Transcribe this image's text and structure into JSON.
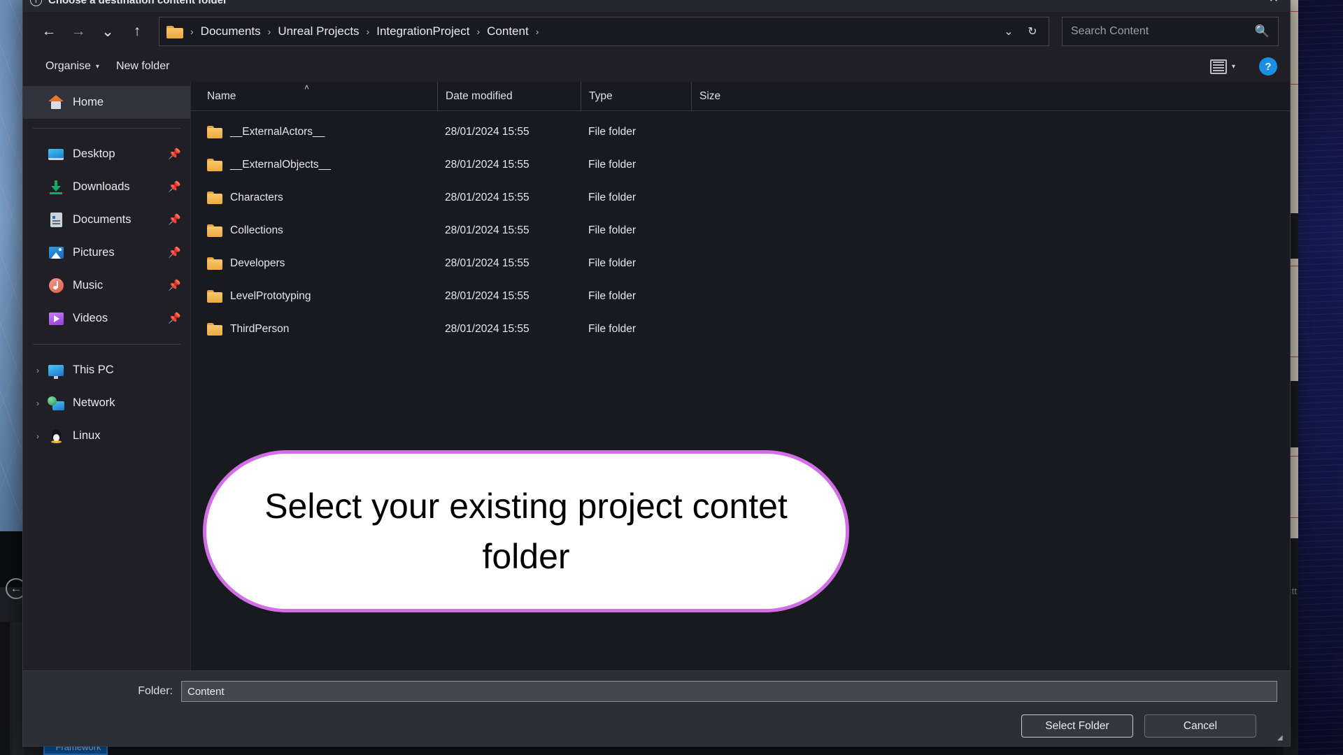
{
  "window": {
    "title": "Choose a destination content folder",
    "title_icon": "info-icon",
    "close_label": "✕"
  },
  "navbar": {
    "back_label": "←",
    "forward_label": "→",
    "recent_label": "⌄",
    "up_label": "↑",
    "breadcrumb": [
      "Documents",
      "Unreal Projects",
      "IntegrationProject",
      "Content"
    ],
    "breadcrumb_separator": "›",
    "dropdown_label": "⌄",
    "refresh_label": "↻",
    "search_placeholder": "Search Content",
    "search_value": "",
    "search_icon": "search-icon"
  },
  "toolbar": {
    "organise_label": "Organise",
    "organise_caret": "▾",
    "new_folder_label": "New folder",
    "view_caret": "▾",
    "help_label": "?"
  },
  "sidebar": {
    "items": [
      {
        "label": "Home",
        "icon": "home-icon",
        "selected": true,
        "pinned": false,
        "expandable": false
      },
      {
        "label": "Desktop",
        "icon": "desktop-icon",
        "selected": false,
        "pinned": true,
        "expandable": false
      },
      {
        "label": "Downloads",
        "icon": "download-icon",
        "selected": false,
        "pinned": true,
        "expandable": false
      },
      {
        "label": "Documents",
        "icon": "document-icon",
        "selected": false,
        "pinned": true,
        "expandable": false
      },
      {
        "label": "Pictures",
        "icon": "picture-icon",
        "selected": false,
        "pinned": true,
        "expandable": false
      },
      {
        "label": "Music",
        "icon": "music-icon",
        "selected": false,
        "pinned": true,
        "expandable": false
      },
      {
        "label": "Videos",
        "icon": "video-icon",
        "selected": false,
        "pinned": true,
        "expandable": false
      },
      {
        "label": "This PC",
        "icon": "computer-icon",
        "selected": false,
        "pinned": false,
        "expandable": true
      },
      {
        "label": "Network",
        "icon": "network-icon",
        "selected": false,
        "pinned": false,
        "expandable": true
      },
      {
        "label": "Linux",
        "icon": "linux-icon",
        "selected": false,
        "pinned": false,
        "expandable": true
      }
    ],
    "pin_glyph": "📌",
    "chevron_glyph": "›"
  },
  "filelist": {
    "columns": [
      "Name",
      "Date modified",
      "Type",
      "Size"
    ],
    "sort_column": "Name",
    "sort_caret": "˄",
    "rows": [
      {
        "name": "__ExternalActors__",
        "date": "28/01/2024 15:55",
        "type": "File folder",
        "size": ""
      },
      {
        "name": "__ExternalObjects__",
        "date": "28/01/2024 15:55",
        "type": "File folder",
        "size": ""
      },
      {
        "name": "Characters",
        "date": "28/01/2024 15:55",
        "type": "File folder",
        "size": ""
      },
      {
        "name": "Collections",
        "date": "28/01/2024 15:55",
        "type": "File folder",
        "size": ""
      },
      {
        "name": "Developers",
        "date": "28/01/2024 15:55",
        "type": "File folder",
        "size": ""
      },
      {
        "name": "LevelPrototyping",
        "date": "28/01/2024 15:55",
        "type": "File folder",
        "size": ""
      },
      {
        "name": "ThirdPerson",
        "date": "28/01/2024 15:55",
        "type": "File folder",
        "size": ""
      }
    ]
  },
  "footer": {
    "folder_label": "Folder:",
    "folder_value": "Content",
    "select_button": "Select Folder",
    "cancel_button": "Cancel",
    "resize_grip": "◢"
  },
  "callout": {
    "text": "Select your existing project contet folder",
    "border_color": "#d26fe6",
    "fill_color": "#ffffff",
    "text_color": "#000000"
  },
  "backdrop": {
    "taskbar_label": "Framework",
    "edge_label": "tt"
  }
}
